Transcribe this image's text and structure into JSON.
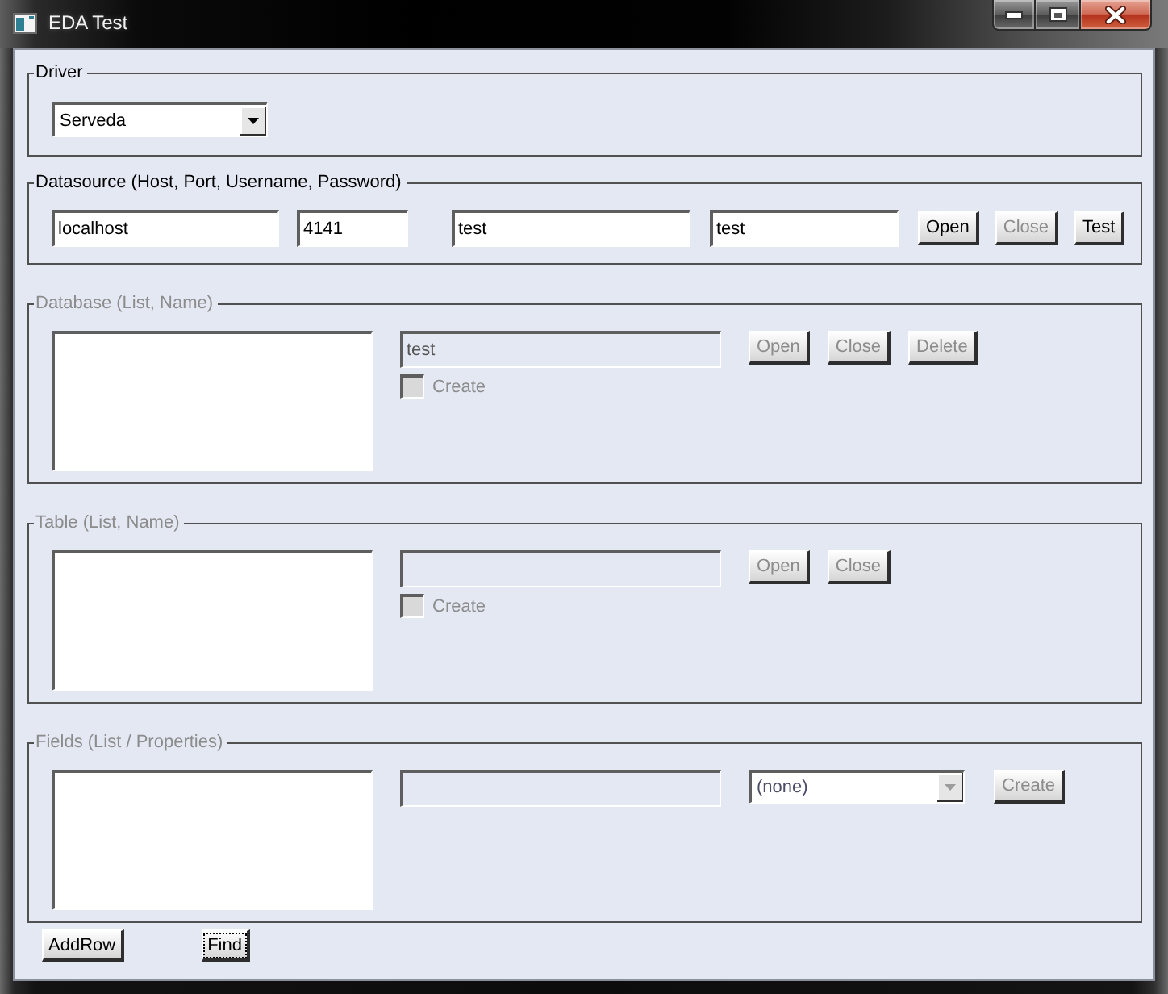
{
  "window": {
    "title": "EDA Test"
  },
  "groups": [
    {
      "kind": "driver",
      "label": "Driver",
      "disabled": false,
      "select": {
        "value": "Serveda",
        "disabled": false
      }
    },
    {
      "kind": "datasource",
      "label": "Datasource (Host, Port, Username, Password)",
      "disabled": false,
      "inputs": [
        {
          "value": "localhost",
          "disabled": false
        },
        {
          "value": "4141",
          "disabled": false
        },
        {
          "value": "test",
          "disabled": false
        },
        {
          "value": "test",
          "disabled": false
        }
      ],
      "buttons": [
        {
          "label": "Open",
          "disabled": false
        },
        {
          "label": "Close",
          "disabled": true
        },
        {
          "label": "Test",
          "disabled": false
        }
      ]
    },
    {
      "kind": "list",
      "label": "Database (List, Name)",
      "disabled": true,
      "name_field": {
        "value": "test",
        "disabled": true
      },
      "checkbox": {
        "label": "Create",
        "checked": false,
        "disabled": true
      },
      "buttons": [
        {
          "label": "Open",
          "disabled": true
        },
        {
          "label": "Close",
          "disabled": true
        },
        {
          "label": "Delete",
          "disabled": true
        }
      ]
    },
    {
      "kind": "list",
      "label": "Table (List, Name)",
      "disabled": true,
      "name_field": {
        "disabled": true
      },
      "checkbox": {
        "label": "Create",
        "checked": false,
        "disabled": true
      },
      "buttons": [
        {
          "label": "Open",
          "disabled": true
        },
        {
          "label": "Close",
          "disabled": true
        }
      ]
    },
    {
      "kind": "list",
      "label": "Fields (List / Properties)",
      "disabled": true,
      "name_field": {
        "disabled": true
      },
      "select": {
        "value": "(none)",
        "disabled": true
      },
      "buttons": [
        {
          "label": "Create",
          "disabled": true
        }
      ]
    }
  ],
  "footer_buttons": [
    {
      "label": "AddRow",
      "focused": false
    },
    {
      "label": "Find",
      "focused": true
    }
  ]
}
